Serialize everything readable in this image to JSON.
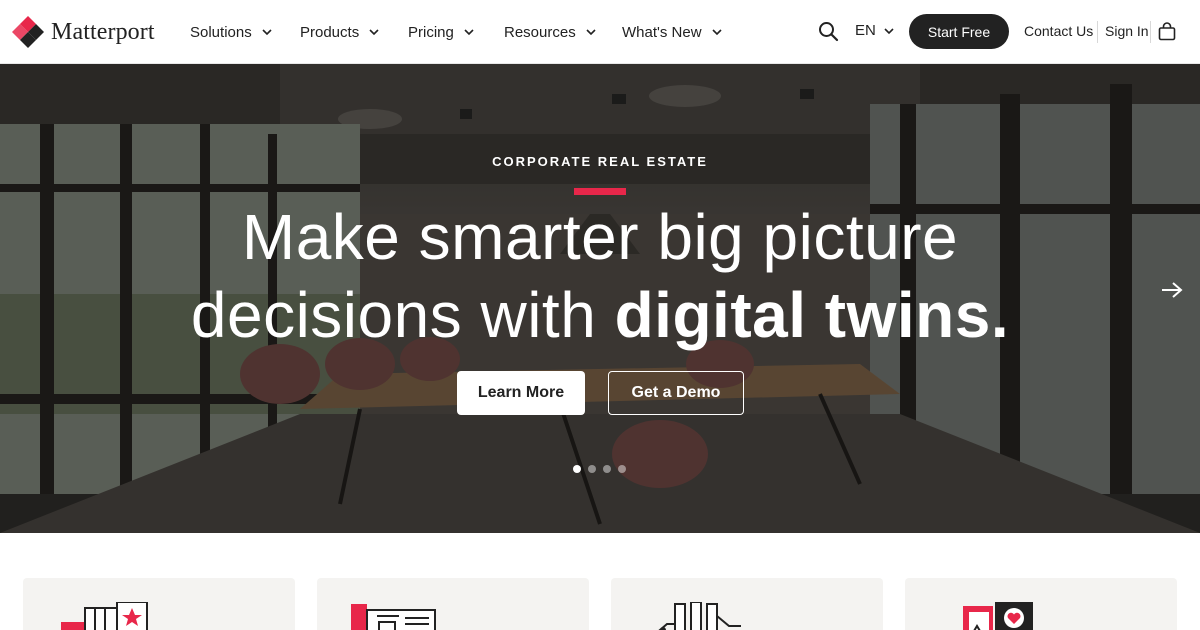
{
  "brand": {
    "name": "Matterport",
    "accent": "#e8274a",
    "dark": "#222222"
  },
  "nav": {
    "items": [
      {
        "label": "Solutions"
      },
      {
        "label": "Products"
      },
      {
        "label": "Pricing"
      },
      {
        "label": "Resources"
      },
      {
        "label": "What's New"
      }
    ]
  },
  "header": {
    "search_icon": "search-icon",
    "language": "EN",
    "start_free": "Start Free",
    "contact": "Contact Us",
    "sign_in": "Sign In",
    "cart_icon": "shopping-bag-icon"
  },
  "hero": {
    "eyebrow": "CORPORATE REAL ESTATE",
    "headline_line1": "Make smarter big picture",
    "headline_line2_regular": "decisions with ",
    "headline_line2_bold": "digital twins.",
    "learn_more": "Learn More",
    "get_demo": "Get a Demo",
    "slides_total": 4,
    "active_slide": 1,
    "next_icon": "arrow-right-icon"
  },
  "cards": [
    {
      "icon": "buildings-star-icon"
    },
    {
      "icon": "blueprint-icon"
    },
    {
      "icon": "factory-icon"
    },
    {
      "icon": "tablet-heart-icon"
    }
  ]
}
